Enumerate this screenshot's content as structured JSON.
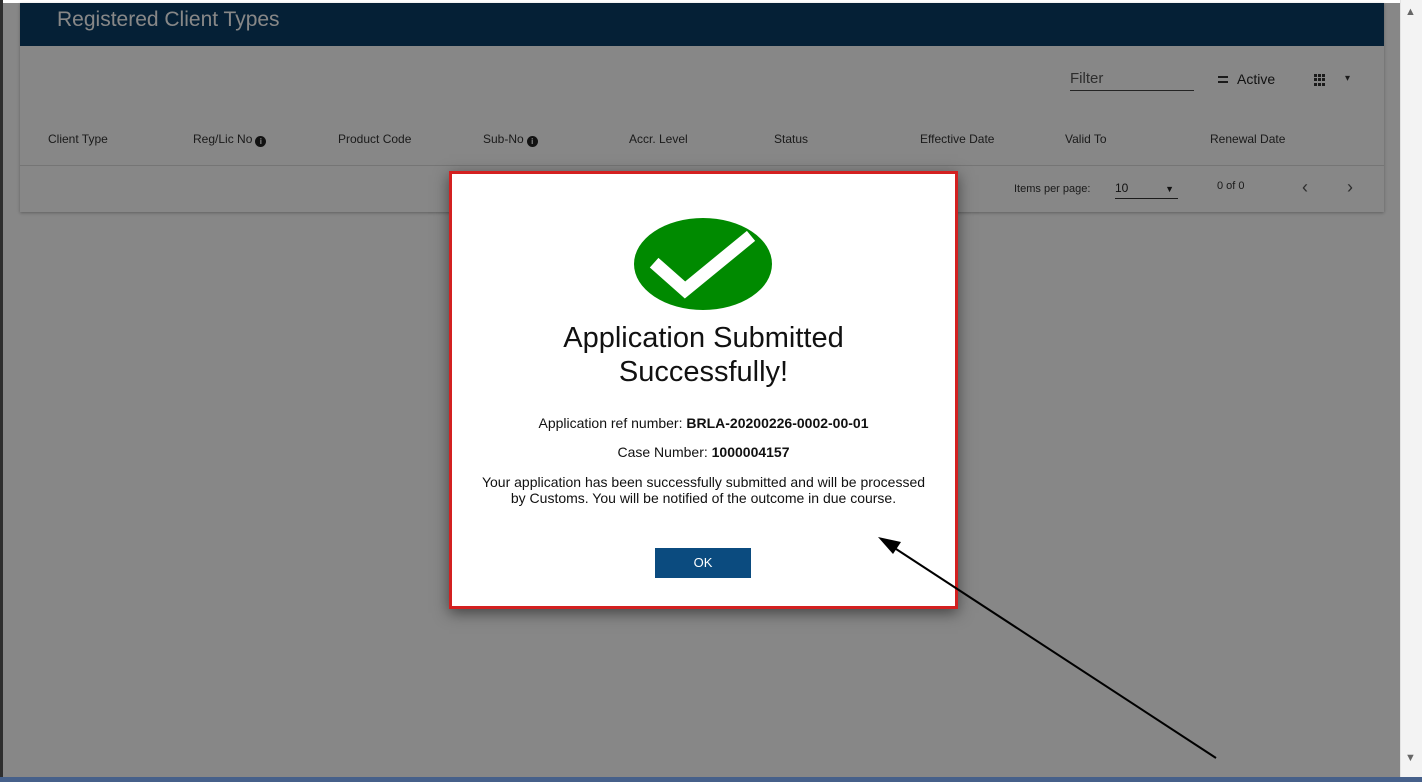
{
  "card": {
    "title": "Registered Client Types",
    "filter_placeholder": "Filter",
    "active_label": "Active",
    "columns": [
      "Client Type",
      "Reg/Lic No",
      "Product Code",
      "Sub-No",
      "Accr. Level",
      "Status",
      "Effective Date",
      "Valid To",
      "Renewal Date"
    ]
  },
  "paginator": {
    "items_per_page_label": "Items per page:",
    "items_per_page_value": "10",
    "range_label": "0 of 0"
  },
  "dialog": {
    "title_line1": "Application Submitted",
    "title_line2": "Successfully!",
    "ref_label": "Application ref number:",
    "ref_value": "BRLA-20200226-0002-00-01",
    "case_label": "Case Number:",
    "case_value": "1000004157",
    "message": "Your application has been successfully submitted and will be processed by Customs. You will be notified of the outcome in due course.",
    "ok_label": "OK"
  },
  "icons": {
    "success": "check-circle-icon",
    "info": "info-icon",
    "filter": "filter-lines-icon",
    "columns": "grid-icon",
    "dropdown": "chevron-down-icon",
    "prev": "chevron-left-icon",
    "next": "chevron-right-icon",
    "annotation": "arrow-icon"
  },
  "colors": {
    "header": "#0b3d66",
    "success_green": "#008a00",
    "dialog_border": "#d32020",
    "ok_button": "#0b4b7f"
  }
}
